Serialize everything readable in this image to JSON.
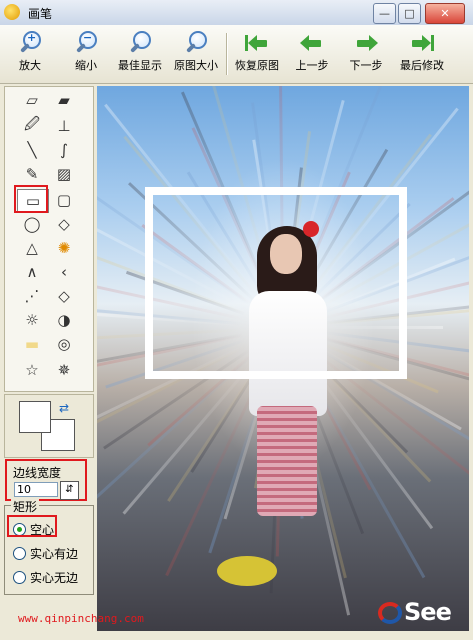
{
  "window": {
    "title": "画笔"
  },
  "toolbar": {
    "zoom_in": "放大",
    "zoom_out": "缩小",
    "best_fit": "最佳显示",
    "actual_size": "原图大小",
    "restore": "恢复原图",
    "prev_step": "上一步",
    "next_step": "下一步",
    "last_edit": "最后修改"
  },
  "border_width": {
    "label": "边线宽度",
    "value": "10"
  },
  "shape": {
    "legend": "矩形",
    "options": [
      "空心",
      "实心有边",
      "实心无边"
    ],
    "selected": "空心"
  },
  "watermark": "www.qinpinchang.com",
  "logo": "See",
  "colors": {
    "highlight": "#e0191e",
    "accent": "#3fa53a"
  }
}
